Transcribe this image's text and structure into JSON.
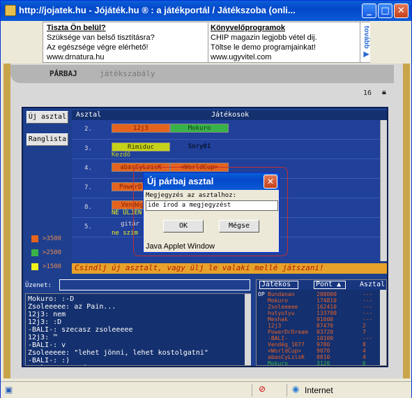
{
  "window": {
    "title": "http://jojatek.hu -     Jójáték.hu ® : a játékportál    /    Játékszoba    (onli...",
    "min": "_",
    "max": "□",
    "close": "✕"
  },
  "ad": {
    "left": {
      "heading": "Tiszta Ön belül?",
      "line1": "Szüksége van belső tisztításra?",
      "line2": "Az egészsége végre elérhető!",
      "line3": "www.drnatura.hu"
    },
    "right": {
      "heading": "Könyvelőprogramok",
      "line1": "CHIP magazin legjobb vétel dij.",
      "line2": "Töltse le demo programjainkat!",
      "line3": "www.ugyvitel.com"
    },
    "more": "tovább ▶"
  },
  "nav": {
    "parbaj": "PÁRBAJ",
    "jatekszabaly": "játékszabály"
  },
  "counter": "16",
  "side": {
    "new_table": "Új asztal",
    "ranking": "Ranglista",
    "legend": [
      {
        "label": ">3500",
        "color": "#e4641f"
      },
      {
        "label": ">2500",
        "color": "#3ab24a"
      },
      {
        "label": ">1500",
        "color": "#f2f21a"
      }
    ]
  },
  "table": {
    "col_table": "Asztal",
    "col_players": "Játékosok",
    "rows": [
      {
        "num": "2.",
        "p1": "12j3",
        "p1_color": "#e4641f",
        "p2": "Mokuro",
        "p2_color": "#3ab24a",
        "note": ""
      },
      {
        "num": "3.",
        "p1": "Rimiduc",
        "p1_color": "#c6d21a",
        "p2": "Sory01",
        "p2_color": "",
        "note": "Kezdő"
      },
      {
        "num": "4.",
        "p1": "abasCyLzisK",
        "p1_color": "#e4641f",
        "p2": "<WorldCup>",
        "p2_color": "#e4641f",
        "note": ""
      },
      {
        "num": "7.",
        "p1": "PowerDr",
        "p1_color": "#e4641f",
        "p2": "",
        "p2_color": "",
        "note": ""
      },
      {
        "num": "8.",
        "p1": "Vendég",
        "p1_color": "#e4641f",
        "p2": "",
        "p2_color": "",
        "note": "NE ÜLJEN"
      },
      {
        "num": "5.",
        "p1": "gitár",
        "p1_color": "",
        "p2": "",
        "p2_color": "",
        "note": "ne szim"
      }
    ]
  },
  "banner": "Csindlj új asztalt, vagy ülj le valaki mellé játszani!",
  "chat": {
    "label": "Üzenet:",
    "log": "Mokuro: :-D\nZsoleeeee: az Pain...\n12j3: nem\n12j3: :D\n-BALI-: szecasz zsoleeeee\n12j3: ™\n-BALI-: v\nZsoleeeee: \"lehet jönni, lehet kostolgatni\"\n-BALI-: :)\nZsoleeeee: csá BALI"
  },
  "players": {
    "col_player": "Játékos",
    "col_points": "Pont ▲",
    "col_table": "Asztal",
    "op": "OP",
    "rows": [
      {
        "name": "Bundanan",
        "points": "208000",
        "table": "---"
      },
      {
        "name": "Mokuro",
        "points": "174810",
        "table": "---"
      },
      {
        "name": "Zsoleeeee",
        "points": "162410",
        "table": "---"
      },
      {
        "name": "hutyutyu",
        "points": "133700",
        "table": "---"
      },
      {
        "name": "Meshak",
        "points": "91600",
        "table": "---"
      },
      {
        "name": "12j3",
        "points": "87470",
        "table": "2"
      },
      {
        "name": "PowerDrDream",
        "points": "83720",
        "table": "7"
      },
      {
        "name": "-BALI-",
        "points": "10100",
        "table": "---"
      },
      {
        "name": "Vendég_1077",
        "points": "9780",
        "table": "8"
      },
      {
        "name": "<WorldCup>",
        "points": "9070",
        "table": "4"
      },
      {
        "name": "abasCyLzisK",
        "points": "8810",
        "table": "4"
      },
      {
        "name": "Mokuro",
        "points": "3120",
        "table": "6"
      }
    ]
  },
  "dialog": {
    "title": "Új párbaj asztal",
    "close": "✕",
    "label": "Megjegyzés az asztalhoz:",
    "input_value": "ide írod a megjegyzést",
    "ok": "OK",
    "cancel": "Mégse",
    "status": "Java Applet Window"
  },
  "statusbar": {
    "zone": "Internet"
  }
}
